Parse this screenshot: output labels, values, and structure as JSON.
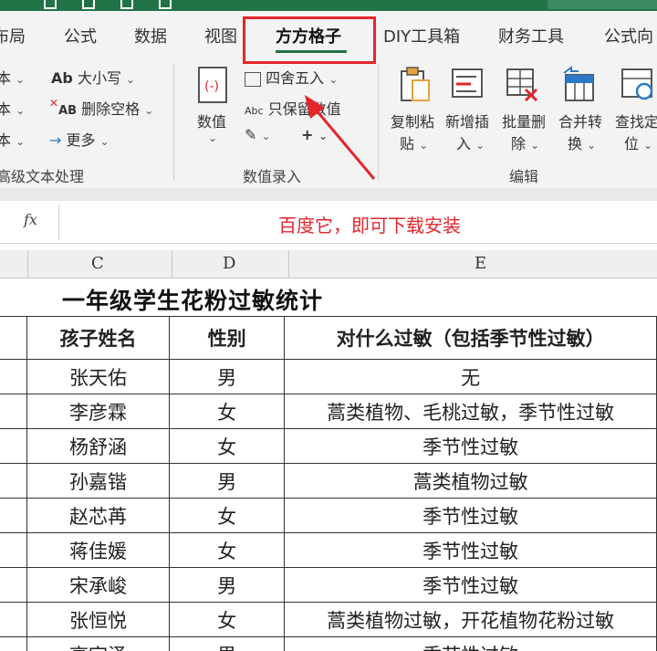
{
  "ribbon_tabs": [
    "布局",
    "公式",
    "数据",
    "视图",
    "方方格子",
    "DIY工具箱",
    "财务工具",
    "公式向"
  ],
  "active_tab": "方方格子",
  "text_group": {
    "items_left": [
      "本",
      "本",
      "本"
    ],
    "case_label": "大小写",
    "case_icon_text": "Ab",
    "delete_space_label": "删除空格",
    "delete_space_icon_text": "AB",
    "more_label": "更多",
    "group_label": "高级文本处理"
  },
  "value_group": {
    "value_button_label": "数值",
    "round_label": "四舍五入",
    "keep_value_label": "只保留数值",
    "keep_value_icon_text": "Abc",
    "group_label": "数值录入"
  },
  "edit_group": {
    "buttons": [
      {
        "top": "复制粘",
        "bottom": "贴"
      },
      {
        "top": "新增插",
        "bottom": "入"
      },
      {
        "top": "批量删",
        "bottom": "除"
      },
      {
        "top": "合并转",
        "bottom": "换"
      },
      {
        "top": "查找定",
        "bottom": "位"
      }
    ],
    "group_label": "编辑"
  },
  "formula_bar": {
    "fx_label": "fx",
    "value": "百度它，即可下载安装"
  },
  "columns": [
    "C",
    "D",
    "E"
  ],
  "sheet": {
    "title": "一年级学生花粉过敏统计",
    "headers": [
      "孩子姓名",
      "性别",
      "对什么过敏（包括季节性过敏）"
    ],
    "rows": [
      [
        "张天佑",
        "男",
        "无"
      ],
      [
        "李彦霖",
        "女",
        "蒿类植物、毛桃过敏，季节性过敏"
      ],
      [
        "杨舒涵",
        "女",
        "季节性过敏"
      ],
      [
        "孙嘉锴",
        "男",
        "蒿类植物过敏"
      ],
      [
        "赵芯苒",
        "女",
        "季节性过敏"
      ],
      [
        "蒋佳媛",
        "女",
        "季节性过敏"
      ],
      [
        "宋承峻",
        "男",
        "季节性过敏"
      ],
      [
        "张恒悦",
        "女",
        "蒿类植物过敏，开花植物花粉过敏"
      ],
      [
        "高宇泽",
        "男",
        "季节性过敏"
      ]
    ]
  },
  "colors": {
    "brand": "#217346",
    "highlight": "#e3262c",
    "formula_text": "#e3262c"
  }
}
